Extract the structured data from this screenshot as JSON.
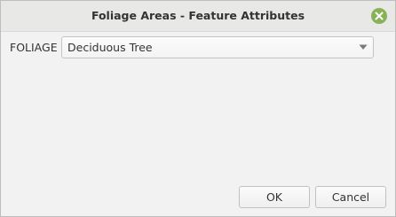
{
  "window": {
    "title": "Foliage Areas - Feature Attributes"
  },
  "form": {
    "field_label": "FOLIAGE",
    "select_value": "Deciduous Tree"
  },
  "buttons": {
    "ok_label": "OK",
    "cancel_label": "Cancel"
  },
  "icons": {
    "close": "close-icon",
    "dropdown": "chevron-down-icon"
  },
  "colors": {
    "close_button": "#88b257"
  }
}
